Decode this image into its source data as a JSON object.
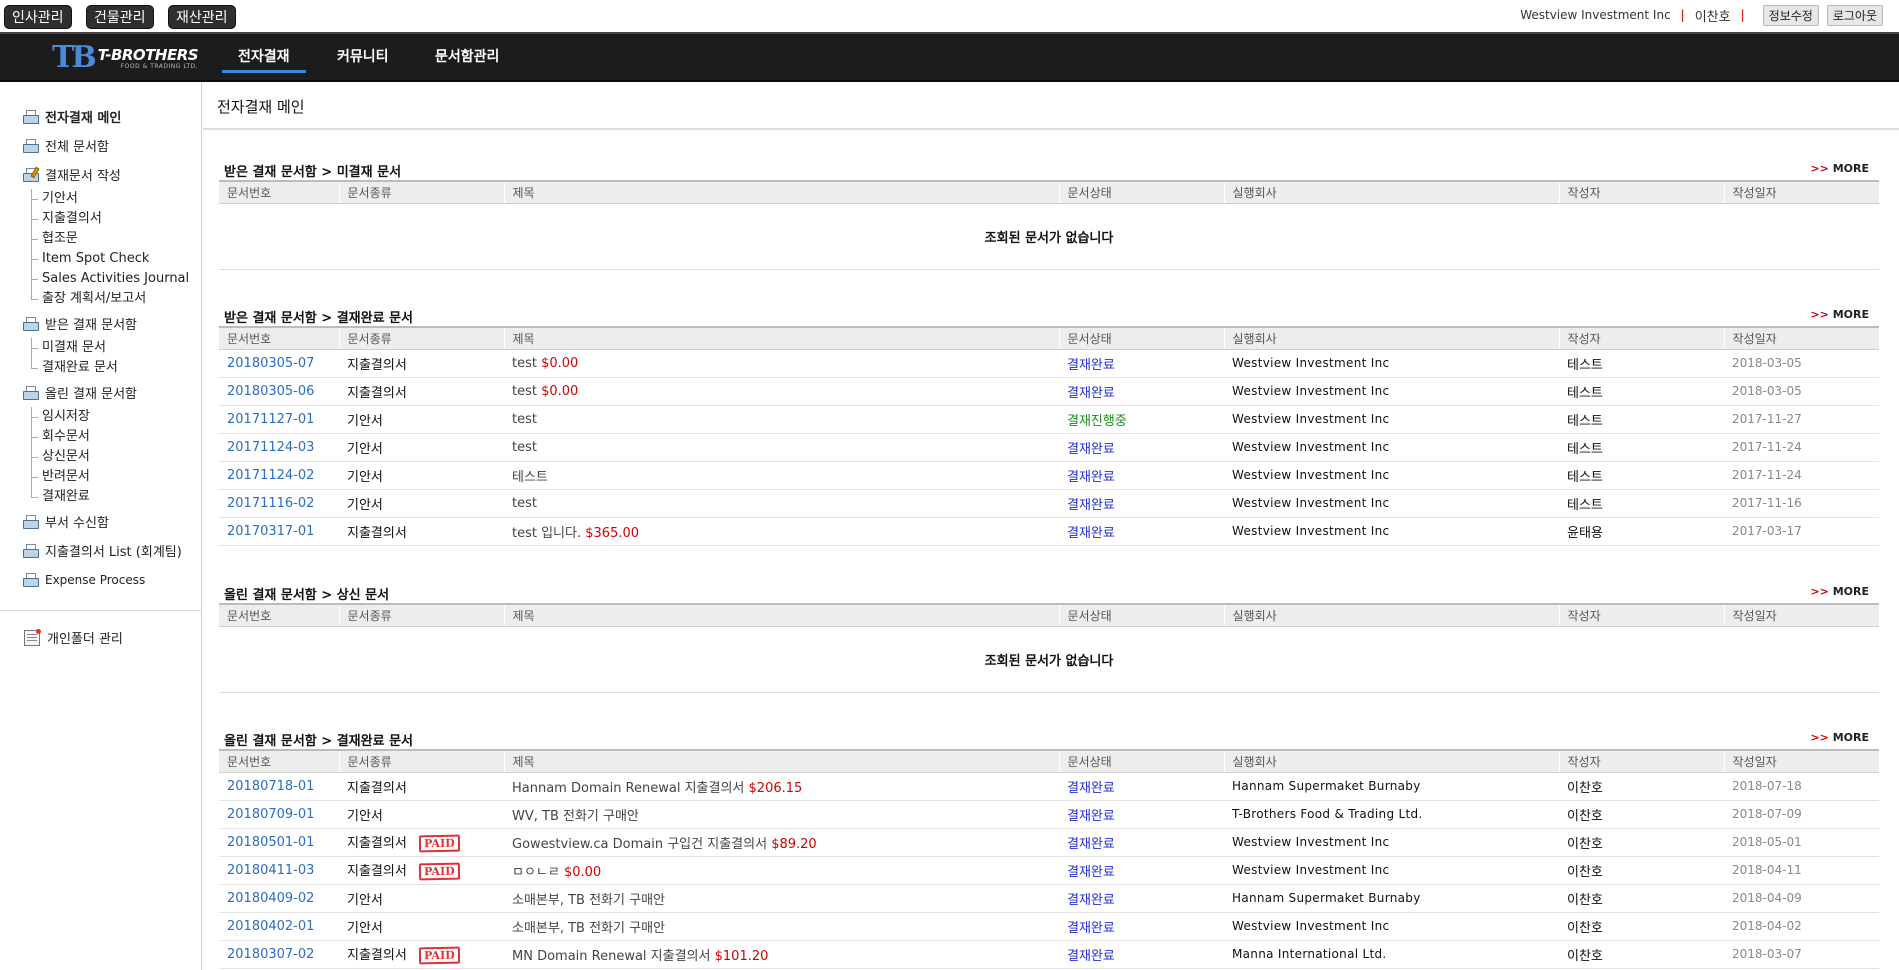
{
  "system_buttons": [
    "인사관리",
    "건물관리",
    "재산관리"
  ],
  "user": {
    "company": "Westview Investment Inc",
    "name": "이찬호",
    "edit_label": "정보수정",
    "logout_label": "로그아웃"
  },
  "logo": {
    "mark": "TB",
    "name": "T-BROTHERS",
    "sub": "FOOD & TRADING LTD."
  },
  "nav": [
    "전자결재",
    "커뮤니티",
    "문서함관리"
  ],
  "sidebar": {
    "main": "전자결재 메인",
    "all_docs": "전체 문서함",
    "compose": "결재문서 작성",
    "compose_sub": [
      "기안서",
      "지출결의서",
      "협조문",
      "Item Spot Check",
      "Sales Activities Journal",
      "출장 계획서/보고서"
    ],
    "received": "받은 결재 문서함",
    "received_sub": [
      "미결재 문서",
      "결재완료 문서"
    ],
    "submitted": "올린 결재 문서함",
    "submitted_sub": [
      "임시저장",
      "회수문서",
      "상신문서",
      "반려문서",
      "결재완료"
    ],
    "dept_inbox": "부서 수신함",
    "expense_list": "지출결의서 List (회계팀)",
    "expense_process": "Expense Process",
    "personal_folder": "개인폴더 관리"
  },
  "page_title": "전자결재 메인",
  "more_label": "MORE",
  "more_arrow": ">>",
  "columns": [
    "문서번호",
    "문서종류",
    "제목",
    "문서상태",
    "실행회사",
    "작성자",
    "작성일자"
  ],
  "empty_text": "조회된 문서가 없습니다",
  "sections": [
    {
      "title": "받은 결재 문서함 > 미결재 문서",
      "rows": []
    },
    {
      "title": "받은 결재 문서함 > 결재완료 문서",
      "rows": [
        {
          "num": "20180305-07",
          "type": "지출결의서",
          "paid": false,
          "title": "test",
          "amount": "$0.00",
          "status": "결재완료",
          "status_kind": "done",
          "company": "Westview Investment Inc",
          "author": "테스트",
          "date": "2018-03-05"
        },
        {
          "num": "20180305-06",
          "type": "지출결의서",
          "paid": false,
          "title": "test",
          "amount": "$0.00",
          "status": "결재완료",
          "status_kind": "done",
          "company": "Westview Investment Inc",
          "author": "테스트",
          "date": "2018-03-05"
        },
        {
          "num": "20171127-01",
          "type": "기안서",
          "paid": false,
          "title": "test",
          "amount": "",
          "status": "결재진행중",
          "status_kind": "progress",
          "company": "Westview Investment Inc",
          "author": "테스트",
          "date": "2017-11-27"
        },
        {
          "num": "20171124-03",
          "type": "기안서",
          "paid": false,
          "title": "test",
          "amount": "",
          "status": "결재완료",
          "status_kind": "done",
          "company": "Westview Investment Inc",
          "author": "테스트",
          "date": "2017-11-24"
        },
        {
          "num": "20171124-02",
          "type": "기안서",
          "paid": false,
          "title": "테스트",
          "amount": "",
          "status": "결재완료",
          "status_kind": "done",
          "company": "Westview Investment Inc",
          "author": "테스트",
          "date": "2017-11-24"
        },
        {
          "num": "20171116-02",
          "type": "기안서",
          "paid": false,
          "title": "test",
          "amount": "",
          "status": "결재완료",
          "status_kind": "done",
          "company": "Westview Investment Inc",
          "author": "테스트",
          "date": "2017-11-16"
        },
        {
          "num": "20170317-01",
          "type": "지출결의서",
          "paid": false,
          "title": "test 입니다.",
          "amount": "$365.00",
          "status": "결재완료",
          "status_kind": "done",
          "company": "Westview Investment Inc",
          "author": "윤태용",
          "date": "2017-03-17"
        }
      ]
    },
    {
      "title": "올린 결재 문서함 > 상신 문서",
      "rows": []
    },
    {
      "title": "올린 결재 문서함 > 결재완료 문서",
      "rows": [
        {
          "num": "20180718-01",
          "type": "지출결의서",
          "paid": false,
          "title": "Hannam Domain Renewal 지출결의서",
          "amount": "$206.15",
          "status": "결재완료",
          "status_kind": "done",
          "company": "Hannam Supermaket Burnaby",
          "author": "이찬호",
          "date": "2018-07-18"
        },
        {
          "num": "20180709-01",
          "type": "기안서",
          "paid": false,
          "title": "WV, TB 전화기 구매안",
          "amount": "",
          "status": "결재완료",
          "status_kind": "done",
          "company": "T-Brothers Food & Trading Ltd.",
          "author": "이찬호",
          "date": "2018-07-09"
        },
        {
          "num": "20180501-01",
          "type": "지출결의서",
          "paid": true,
          "title": "Gowestview.ca Domain 구입건 지출결의서",
          "amount": "$89.20",
          "status": "결재완료",
          "status_kind": "done",
          "company": "Westview Investment Inc",
          "author": "이찬호",
          "date": "2018-05-01"
        },
        {
          "num": "20180411-03",
          "type": "지출결의서",
          "paid": true,
          "title": "ㅁㅇㄴㄹ",
          "amount": "$0.00",
          "status": "결재완료",
          "status_kind": "done",
          "company": "Westview Investment Inc",
          "author": "이찬호",
          "date": "2018-04-11"
        },
        {
          "num": "20180409-02",
          "type": "기안서",
          "paid": false,
          "title": "소매본부, TB 전화기 구매안",
          "amount": "",
          "status": "결재완료",
          "status_kind": "done",
          "company": "Hannam Supermaket Burnaby",
          "author": "이찬호",
          "date": "2018-04-09"
        },
        {
          "num": "20180402-01",
          "type": "기안서",
          "paid": false,
          "title": "소매본부, TB 전화기 구매안",
          "amount": "",
          "status": "결재완료",
          "status_kind": "done",
          "company": "Westview Investment Inc",
          "author": "이찬호",
          "date": "2018-04-02"
        },
        {
          "num": "20180307-02",
          "type": "지출결의서",
          "paid": true,
          "title": "MN Domain Renewal 지출결의서",
          "amount": "$101.20",
          "status": "결재완료",
          "status_kind": "done",
          "company": "Manna International Ltd.",
          "author": "이찬호",
          "date": "2018-03-07"
        }
      ]
    }
  ],
  "paid_stamp": "PAID",
  "colors": {
    "accent": "#3a86d8",
    "amount": "#d40000",
    "status_done": "#1f2fd0",
    "status_progress": "#1c8c1c",
    "doc_number": "#2b6cc4"
  }
}
